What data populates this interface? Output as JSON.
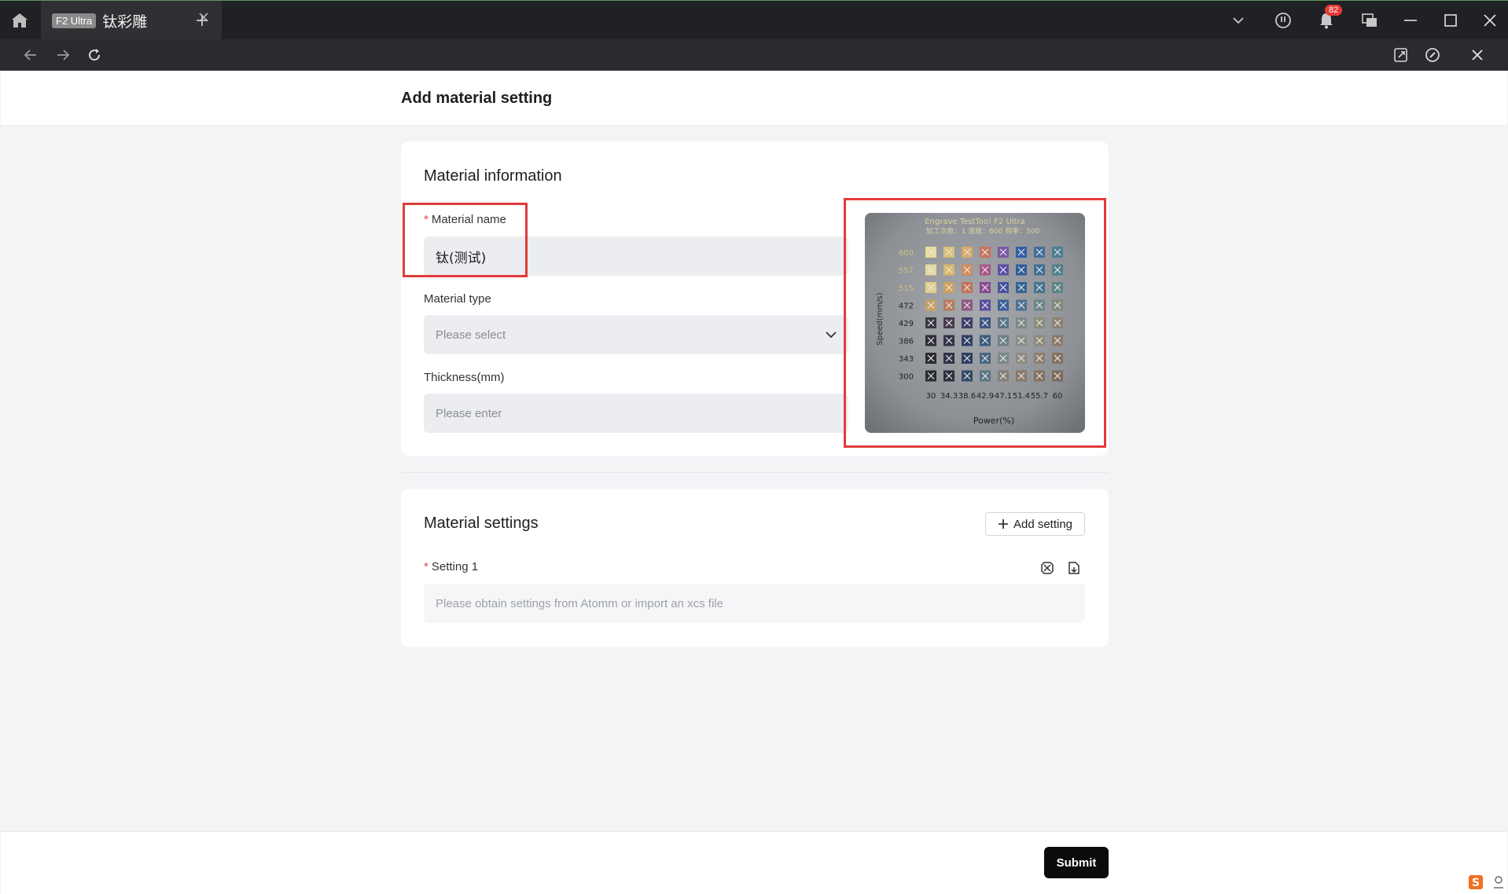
{
  "browser": {
    "tab_badge": "F2 Ultra",
    "tab_title": "钛彩雕",
    "notification_count": "82"
  },
  "page": {
    "title": "Add material setting"
  },
  "material_info": {
    "section_title": "Material information",
    "name_label": "Material name",
    "name_value": "钛(测试)",
    "type_label": "Material type",
    "type_placeholder": "Please select",
    "thickness_label": "Thickness(mm)",
    "thickness_placeholder": "Please enter"
  },
  "test_photo": {
    "header_line1": "Engrave TestToo! F2 Ultra",
    "header_line2": "加工次数：1 速度：600 频率：500",
    "y_axis_label": "Speed(mm/s)",
    "y_ticks": [
      "600",
      "557",
      "515",
      "472",
      "429",
      "386",
      "343",
      "300"
    ],
    "x_ticks": [
      "30",
      "34.3",
      "38.6",
      "42.9",
      "47.1",
      "51.4",
      "55.7",
      "60"
    ],
    "x_axis_label": "Power(%)"
  },
  "material_settings": {
    "section_title": "Material settings",
    "add_button": "Add setting",
    "setting_label": "Setting 1",
    "setting_placeholder": "Please obtain settings from Atomm or import an xcs file"
  },
  "footer": {
    "submit": "Submit"
  },
  "colors": {
    "highlight": "#e23b3b",
    "titlebar": "#202124",
    "navbar": "#2a2b2e",
    "required": "#e5484d",
    "submit_bg": "#0b0b0b"
  }
}
